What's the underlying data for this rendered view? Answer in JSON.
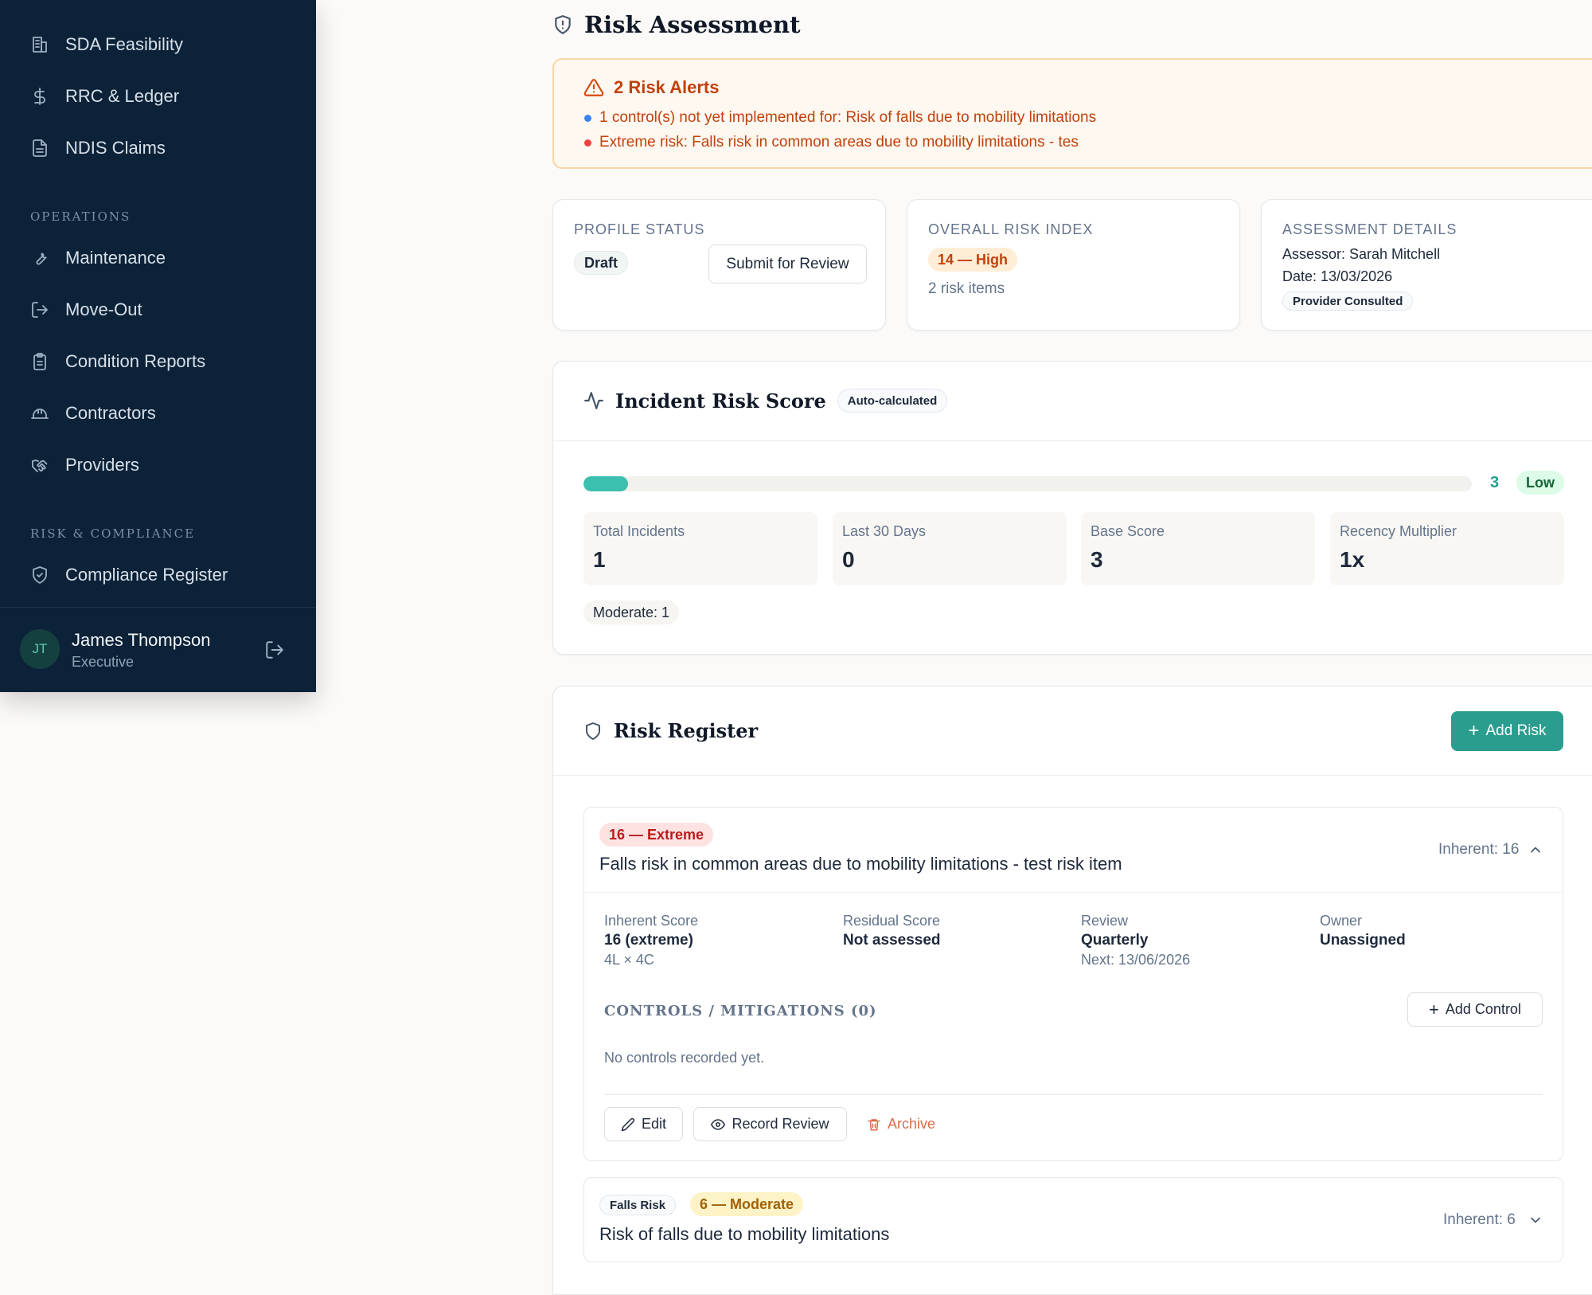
{
  "sidebar": {
    "items_top": [
      {
        "label": "SDA Feasibility",
        "icon": "building-icon"
      },
      {
        "label": "RRC & Ledger",
        "icon": "dollar-icon"
      },
      {
        "label": "NDIS Claims",
        "icon": "document-icon"
      }
    ],
    "section_operations": "OPERATIONS",
    "items_ops": [
      {
        "label": "Maintenance",
        "icon": "wrench-icon"
      },
      {
        "label": "Move-Out",
        "icon": "exit-icon"
      },
      {
        "label": "Condition Reports",
        "icon": "clipboard-icon"
      },
      {
        "label": "Contractors",
        "icon": "hardhat-icon"
      },
      {
        "label": "Providers",
        "icon": "handshake-icon"
      }
    ],
    "section_risk": "RISK & COMPLIANCE",
    "items_risk": [
      {
        "label": "Compliance Register",
        "icon": "shield-check-icon"
      }
    ],
    "user": {
      "initials": "JT",
      "name": "James Thompson",
      "role": "Executive"
    }
  },
  "page": {
    "title": "Risk Assessment"
  },
  "alerts": {
    "title": "2 Risk Alerts",
    "items": [
      {
        "text": "1 control(s) not yet implemented for: Risk of falls due to mobility limitations",
        "color": "#3b82f6"
      },
      {
        "text": "Extreme risk: Falls risk in common areas due to mobility limitations - tes",
        "color": "#ef4444"
      }
    ]
  },
  "profile_status": {
    "label": "PROFILE STATUS",
    "status": "Draft",
    "submit_label": "Submit for Review"
  },
  "risk_index": {
    "label": "OVERALL RISK INDEX",
    "value": "14 — High",
    "items": "2 risk items"
  },
  "assessment": {
    "label": "ASSESSMENT DETAILS",
    "assessor": "Assessor: Sarah Mitchell",
    "date": "Date: 13/03/2026",
    "badge": "Provider Consulted"
  },
  "incident": {
    "title": "Incident Risk Score",
    "badge": "Auto-calculated",
    "score": "3",
    "level": "Low",
    "progress_fraction": 0.03,
    "stats": [
      {
        "label": "Total Incidents",
        "value": "1"
      },
      {
        "label": "Last 30 Days",
        "value": "0"
      },
      {
        "label": "Base Score",
        "value": "3"
      },
      {
        "label": "Recency Multiplier",
        "value": "1x"
      }
    ],
    "breakdown": "Moderate: 1"
  },
  "register": {
    "title": "Risk Register",
    "add_label": "Add Risk",
    "risks": [
      {
        "score_badge": "16 — Extreme",
        "title": "Falls risk in common areas due to mobility limitations - test risk item",
        "inherent": "Inherent: 16",
        "details": {
          "inherent_label": "Inherent Score",
          "inherent_value": "16 (extreme)",
          "inherent_sub": "4L × 4C",
          "residual_label": "Residual Score",
          "residual_value": "Not assessed",
          "review_label": "Review",
          "review_value": "Quarterly",
          "review_sub": "Next: 13/06/2026",
          "owner_label": "Owner",
          "owner_value": "Unassigned"
        },
        "controls_title": "CONTROLS / MITIGATIONS (0)",
        "add_control": "Add Control",
        "no_controls": "No controls recorded yet.",
        "actions": {
          "edit": "Edit",
          "review": "Record Review",
          "archive": "Archive"
        }
      },
      {
        "category": "Falls Risk",
        "score_badge": "6 — Moderate",
        "title": "Risk of falls due to mobility limitations",
        "inherent": "Inherent: 6"
      }
    ]
  },
  "colors": {
    "sidebar_bg": "#0c2238",
    "accent": "#2a9d8f",
    "extreme": "#dc2626",
    "high": "#c2410c",
    "moderate": "#a16207"
  }
}
